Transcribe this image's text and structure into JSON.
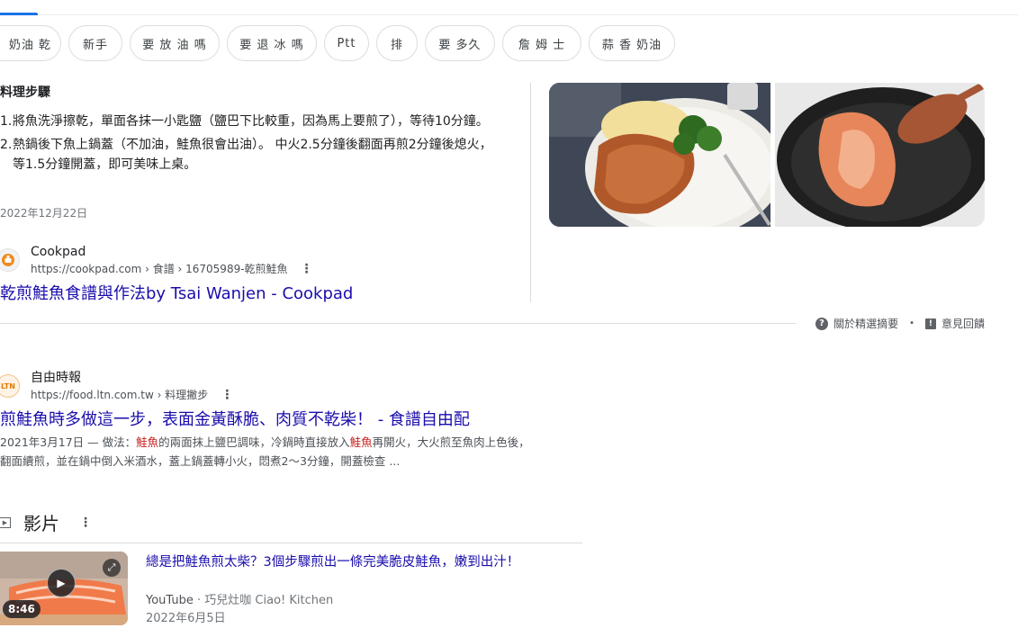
{
  "colors": {
    "link": "#1a0dab",
    "accent": "#1a73e8",
    "highlight": "#c5221f"
  },
  "chips": [
    "奶油 乾",
    "新手",
    "要 放 油 嗎",
    "要 退 冰 嗎",
    "Ptt",
    "排",
    "要 多久",
    "詹 姆 士",
    "蒜 香 奶油"
  ],
  "snippet": {
    "heading": "料理步驟",
    "steps": [
      {
        "num": "1.",
        "text": "將魚洗淨擦乾，單面各抹一小匙鹽（鹽巴下比較重，因為馬上要煎了），等待10分鐘。"
      },
      {
        "num": "2.",
        "text": "熱鍋後下魚上鍋蓋（不加油，鮭魚很會出油）。 中火2.5分鐘後翻面再煎2分鐘後熄火，等1.5分鐘開蓋，即可美味上桌。"
      }
    ],
    "date": "2022年12月22日",
    "site_name": "Cookpad",
    "site_url": "https://cookpad.com › 食譜 › 16705989-乾煎鮭魚",
    "title": "乾煎鮭魚食譜與作法by Tsai Wanjen - Cookpad",
    "foot_about": "關於精選摘要",
    "foot_feedback": "意見回饋",
    "foot_dot": "•"
  },
  "result2": {
    "site_name": "自由時報",
    "favicon_text": "LTN",
    "site_url": "https://food.ltn.com.tw › 料理撇步",
    "title": "煎鮭魚時多做這一步，表面金黃酥脆、肉質不乾柴！ - 食譜自由配",
    "desc_date": "2021年3月17日 — 做法：",
    "desc_hl1": "鮭魚",
    "desc_mid": "的兩面抹上鹽巴調味，冷鍋時直接放入",
    "desc_hl2": "鮭魚",
    "desc_end": "再開火，大火煎至魚肉上色後，翻面續煎，並在鍋中倒入米酒水，蓋上鍋蓋轉小火，悶煮2～3分鐘，開蓋檢查 ..."
  },
  "videos": {
    "heading": "影片",
    "item": {
      "title": "總是把鮭魚煎太柴？3個步驟煎出一條完美脆皮鮭魚，嫩到出汁！",
      "source": "YouTube",
      "sep": " · ",
      "channel": "巧兒灶咖 Ciao! Kitchen",
      "date": "2022年6月5日",
      "duration": "8:46"
    }
  }
}
